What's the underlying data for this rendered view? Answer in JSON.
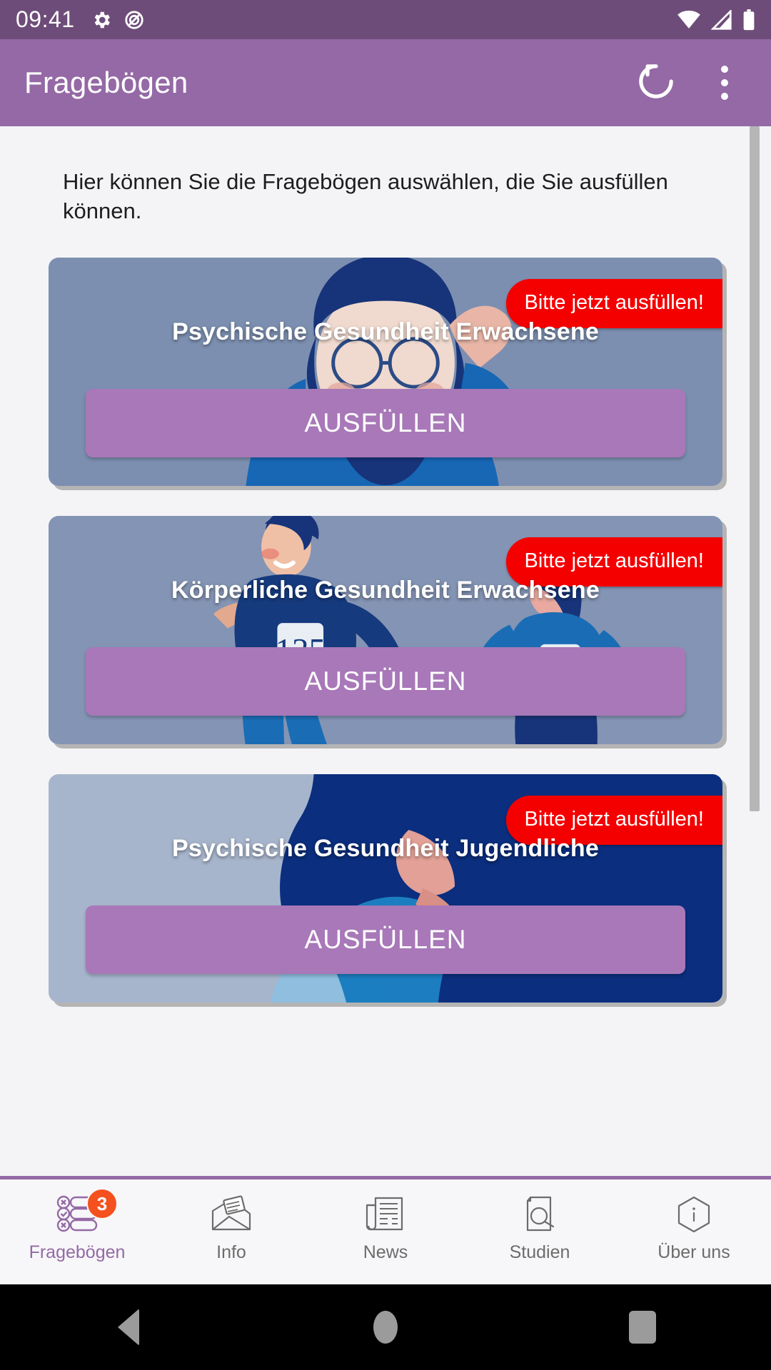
{
  "status_bar": {
    "time": "09:41",
    "left_icons": [
      "settings-gear-icon",
      "do-not-disturb-icon"
    ],
    "right_icons": [
      "wifi-icon",
      "cellular-signal-icon",
      "battery-icon"
    ],
    "background_color": "#6E4C79"
  },
  "app_bar": {
    "title": "Fragebögen",
    "background_color": "#9469A5",
    "actions": [
      {
        "name": "refresh-button",
        "icon": "refresh-icon"
      },
      {
        "name": "overflow-menu-button",
        "icon": "more-vertical-icon"
      }
    ]
  },
  "main": {
    "intro_text": "Hier können Sie die Fragebögen auswählen, die Sie ausfüllen können.",
    "badge_color": "#f50000",
    "button_color": "#A878B8",
    "cards": [
      {
        "title": "Psychische Gesundheit Erwachsene",
        "badge": "Bitte jetzt ausfüllen!",
        "button": "AUSFÜLLEN",
        "art": "bearded-man-confused-illustration"
      },
      {
        "title": "Körperliche Gesundheit Erwachsene",
        "badge": "Bitte jetzt ausfüllen!",
        "button": "AUSFÜLLEN",
        "art": "two-runners-illustration"
      },
      {
        "title": "Psychische Gesundheit Jugendliche",
        "badge": "Bitte jetzt ausfüllen!",
        "button": "AUSFÜLLEN",
        "art": "sad-teen-hugging-knees-illustration"
      }
    ]
  },
  "bottom_nav": {
    "active_color": "#9469A5",
    "inactive_color": "#6c6c6c",
    "badge_color": "#F4511E",
    "items": [
      {
        "label": "Fragebögen",
        "icon": "checklist-icon",
        "badge": "3",
        "active": true
      },
      {
        "label": "Info",
        "icon": "envelope-letter-icon",
        "badge": "",
        "active": false
      },
      {
        "label": "News",
        "icon": "newspaper-icon",
        "badge": "",
        "active": false
      },
      {
        "label": "Studien",
        "icon": "document-search-icon",
        "badge": "",
        "active": false
      },
      {
        "label": "Über uns",
        "icon": "hexagon-info-icon",
        "badge": "",
        "active": false
      }
    ]
  },
  "android_nav": {
    "buttons": [
      "back-button",
      "home-button",
      "recents-button"
    ]
  }
}
